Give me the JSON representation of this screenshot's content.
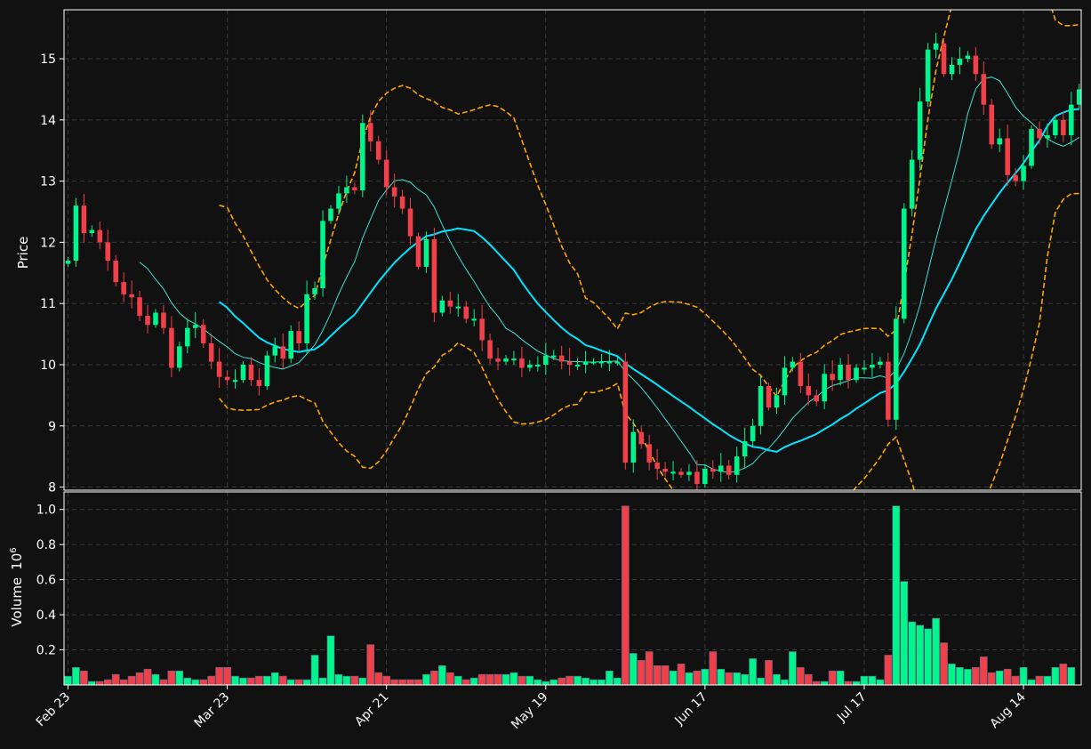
{
  "chart_data": {
    "type": "candlestick",
    "colors": {
      "background": "#111111",
      "up": "#00f58c",
      "down": "#f0404a",
      "grid": "#3a3a3a",
      "ma_short": "#3fe0d0",
      "ma_long": "#00e5ff",
      "bands": "#ffa500",
      "axis": "#ffffff"
    },
    "price_panel": {
      "ylabel": "Price",
      "ylim": [
        7.95,
        15.8
      ],
      "yticks": [
        8,
        9,
        10,
        11,
        12,
        13,
        14,
        15
      ]
    },
    "volume_panel": {
      "ylabel": "Volume",
      "yunit": "10",
      "yunit_exp": "6",
      "ylim": [
        0,
        1.1
      ],
      "yticks": [
        0.2,
        0.4,
        0.6,
        0.8,
        1.0
      ],
      "ytick_labels": [
        "0.2",
        "0.4",
        "0.6",
        "0.8",
        "1.0"
      ]
    },
    "x_ticks": [
      {
        "index": 0,
        "label": "Feb 23"
      },
      {
        "index": 20,
        "label": "Mar 23"
      },
      {
        "index": 40,
        "label": "Apr 21"
      },
      {
        "index": 60,
        "label": "May 19"
      },
      {
        "index": 80,
        "label": "Jun 17"
      },
      {
        "index": 100,
        "label": "Jul 17"
      },
      {
        "index": 120,
        "label": "Aug 14"
      }
    ],
    "candles_close": [
      11.7,
      12.6,
      12.15,
      12.2,
      12.0,
      11.7,
      11.35,
      11.15,
      11.1,
      10.8,
      10.65,
      10.85,
      10.6,
      9.95,
      10.3,
      10.6,
      10.65,
      10.35,
      10.05,
      9.8,
      9.75,
      9.75,
      10.0,
      9.75,
      9.65,
      10.15,
      10.3,
      10.1,
      10.55,
      10.35,
      11.15,
      11.25,
      12.35,
      12.55,
      12.8,
      12.9,
      12.85,
      13.95,
      13.65,
      13.35,
      12.9,
      12.75,
      12.55,
      12.1,
      11.6,
      12.05,
      10.85,
      11.05,
      10.95,
      10.95,
      10.75,
      10.75,
      10.4,
      10.1,
      10.05,
      10.1,
      10.1,
      9.95,
      10.0,
      10.0,
      10.15,
      10.15,
      10.05,
      10.0,
      10.0,
      10.05,
      10.05,
      10.05,
      10.05,
      10.05,
      8.4,
      8.9,
      8.7,
      8.4,
      8.3,
      8.25,
      8.25,
      8.2,
      8.25,
      8.05,
      8.3,
      8.25,
      8.35,
      8.2,
      8.5,
      8.75,
      9.0,
      9.65,
      9.3,
      9.5,
      9.95,
      10.05,
      9.65,
      9.5,
      9.4,
      9.85,
      9.75,
      10.0,
      9.75,
      9.95,
      9.95,
      10.0,
      10.05,
      9.1,
      10.75,
      12.55,
      13.35,
      14.3,
      15.15,
      15.25,
      14.75,
      14.9,
      15.0,
      15.05,
      14.75,
      14.25,
      13.6,
      13.7,
      13.1,
      13.0,
      13.25,
      13.85,
      13.7,
      13.75,
      14.0,
      13.75,
      14.25,
      14.5
    ],
    "volume": [
      0.05,
      0.1,
      0.08,
      0.02,
      0.02,
      0.03,
      0.06,
      0.03,
      0.05,
      0.07,
      0.09,
      0.06,
      0.03,
      0.08,
      0.08,
      0.04,
      0.03,
      0.03,
      0.05,
      0.1,
      0.1,
      0.05,
      0.04,
      0.04,
      0.05,
      0.05,
      0.07,
      0.05,
      0.03,
      0.03,
      0.03,
      0.17,
      0.04,
      0.28,
      0.06,
      0.05,
      0.05,
      0.04,
      0.23,
      0.07,
      0.05,
      0.03,
      0.03,
      0.03,
      0.03,
      0.06,
      0.08,
      0.11,
      0.07,
      0.05,
      0.03,
      0.04,
      0.06,
      0.06,
      0.06,
      0.06,
      0.07,
      0.05,
      0.05,
      0.03,
      0.02,
      0.03,
      0.04,
      0.05,
      0.05,
      0.04,
      0.03,
      0.03,
      0.08,
      0.04,
      1.02,
      0.18,
      0.14,
      0.19,
      0.11,
      0.11,
      0.08,
      0.12,
      0.07,
      0.08,
      0.09,
      0.19,
      0.09,
      0.07,
      0.07,
      0.06,
      0.15,
      0.04,
      0.14,
      0.06,
      0.03,
      0.19,
      0.1,
      0.06,
      0.02,
      0.02,
      0.08,
      0.08,
      0.02,
      0.02,
      0.05,
      0.05,
      0.03,
      0.17,
      1.02,
      0.59,
      0.36,
      0.34,
      0.32,
      0.38,
      0.24,
      0.12,
      0.1,
      0.09,
      0.1,
      0.16,
      0.07,
      0.08,
      0.09,
      0.05,
      0.1,
      0.03,
      0.05,
      0.05,
      0.1,
      0.12,
      0.1
    ]
  }
}
